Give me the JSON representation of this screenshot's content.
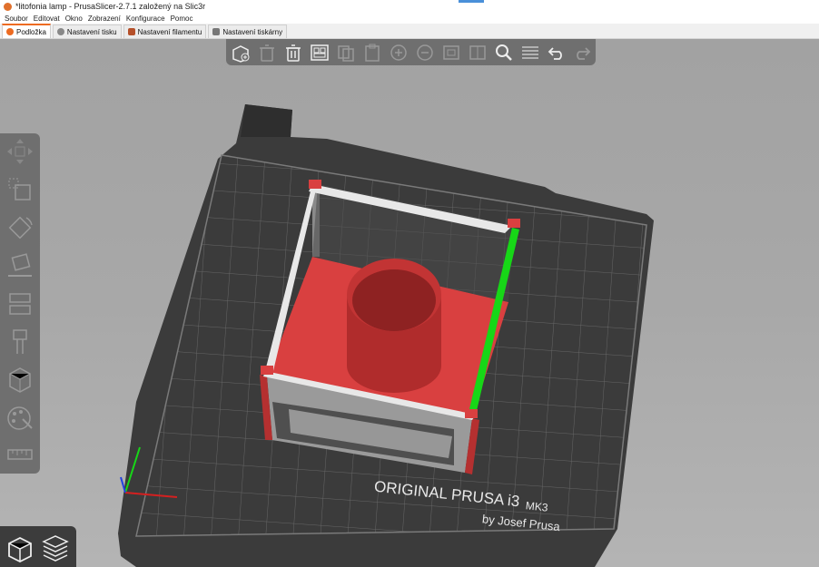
{
  "window": {
    "title": "*litofonia lamp - PrusaSlicer-2.7.1 založený na Slic3r"
  },
  "menu": [
    "Soubor",
    "Editovat",
    "Okno",
    "Zobrazení",
    "Konfigurace",
    "Pomoc"
  ],
  "tabs": [
    {
      "label": "Podložka",
      "active": true,
      "icon": "plater-icon"
    },
    {
      "label": "Nastavení tisku",
      "active": false,
      "icon": "print-settings-icon"
    },
    {
      "label": "Nastavení filamentu",
      "active": false,
      "icon": "filament-icon"
    },
    {
      "label": "Nastavení tiskárny",
      "active": false,
      "icon": "printer-icon"
    }
  ],
  "toolbar": [
    "add-object-icon",
    "delete-icon",
    "delete-all-icon",
    "arrange-icon",
    "copy-icon",
    "paste-icon",
    "add-instance-icon",
    "remove-instance-icon",
    "split-objects-icon",
    "split-parts-icon",
    "layer-editing-icon",
    "search-icon",
    "variable-layer-icon",
    "undo-icon",
    "redo-icon"
  ],
  "gizmos": [
    "move-icon",
    "scale-icon",
    "rotate-icon",
    "place-on-face-icon",
    "cut-icon",
    "paint-supports-icon",
    "seam-icon",
    "mmu-segmentation-icon",
    "measure-icon"
  ],
  "view_toggle": [
    "3d-view-icon",
    "preview-icon"
  ],
  "bed": {
    "brand_line1": "ORIGINAL PRUSA i3",
    "brand_model": "MK3",
    "brand_line2": "by Josef Prusa"
  },
  "colors": {
    "accent": "#ed6b21",
    "object": "#d94040",
    "bed": "#3b3b3b",
    "selection": "#17d717"
  }
}
